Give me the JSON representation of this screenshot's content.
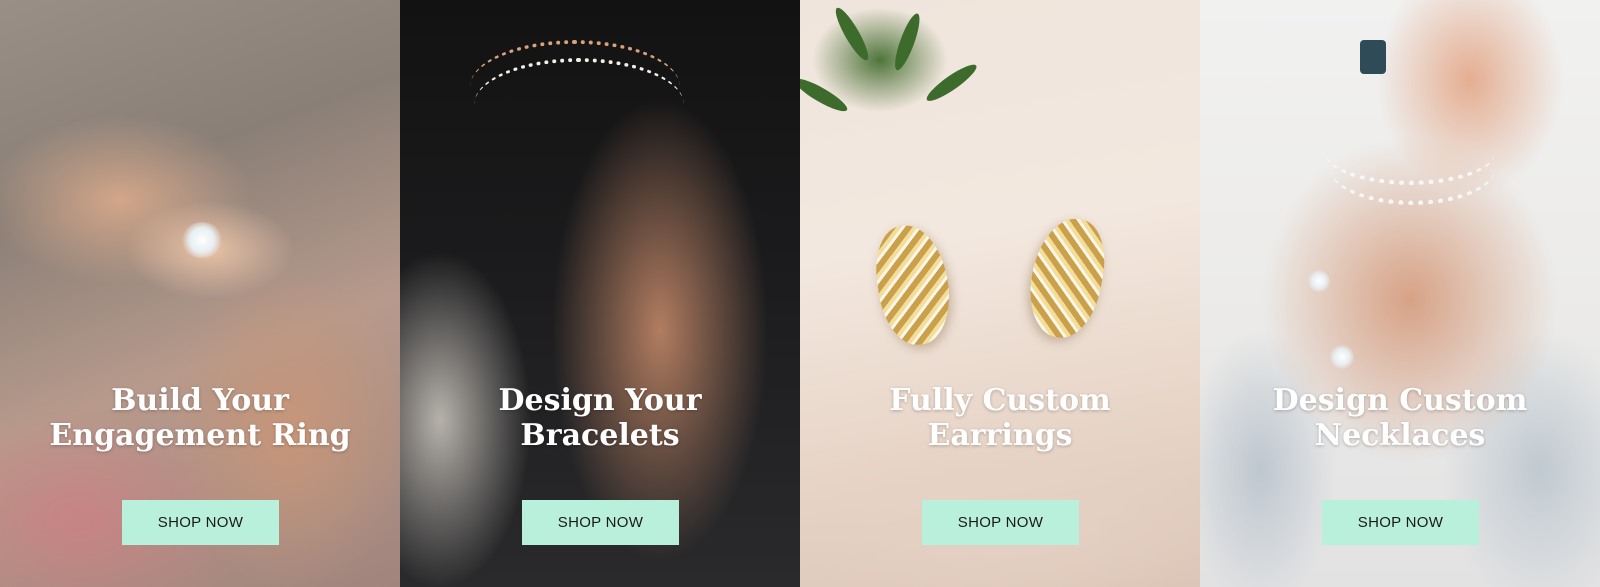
{
  "panels": [
    {
      "title_line1": "Build Your",
      "title_line2": "Engagement Ring",
      "button": "SHOP NOW"
    },
    {
      "title_line1": "Design Your",
      "title_line2": "Bracelets",
      "button": "SHOP NOW"
    },
    {
      "title_line1": "Fully Custom",
      "title_line2": "Earrings",
      "button": "SHOP NOW"
    },
    {
      "title_line1": "Design Custom",
      "title_line2": "Necklaces",
      "button": "SHOP NOW"
    }
  ],
  "colors": {
    "button_bg": "#b8f0dc",
    "button_text": "#1a1a1a",
    "title_text": "#ffffff"
  }
}
